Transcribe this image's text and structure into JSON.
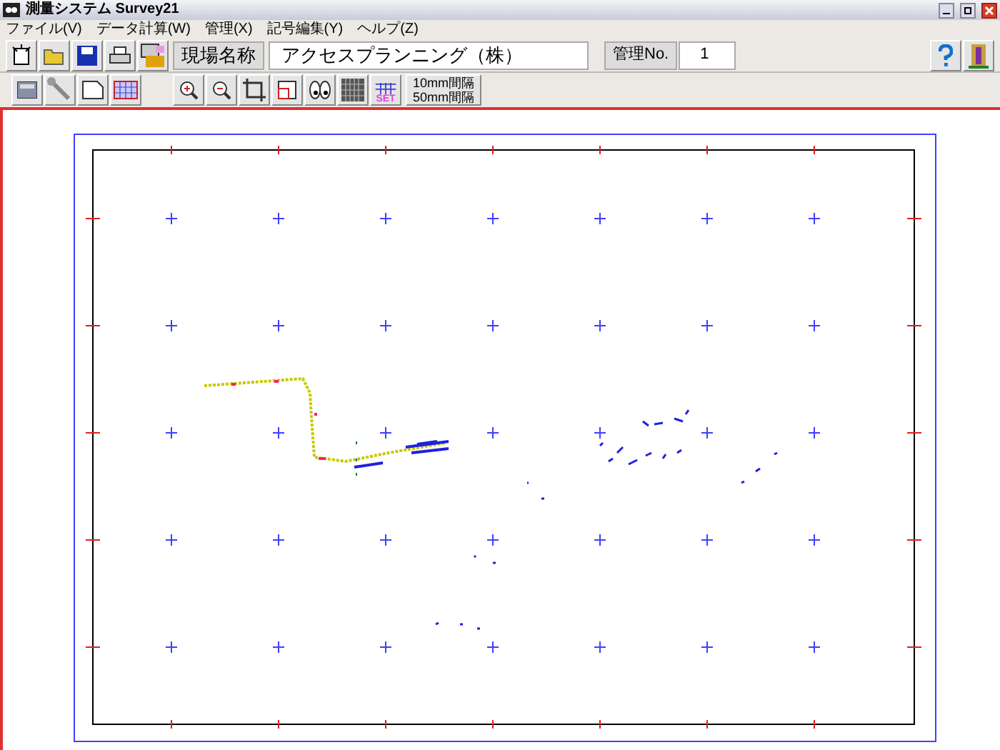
{
  "window": {
    "title": "測量システム Survey21"
  },
  "menus": [
    {
      "label": "ファイル(V)"
    },
    {
      "label": "データ計算(W)"
    },
    {
      "label": "管理(X)"
    },
    {
      "label": "記号編集(Y)"
    },
    {
      "label": "ヘルプ(Z)"
    }
  ],
  "toolbar": {
    "site_label": "現場名称",
    "site_value": "アクセスプランニング（株）",
    "mgmt_label": "管理No.",
    "mgmt_value": "1"
  },
  "toolbar2": {
    "set_label": "SET",
    "interval_lines": [
      "10mm間隔",
      "50mm間隔"
    ]
  }
}
